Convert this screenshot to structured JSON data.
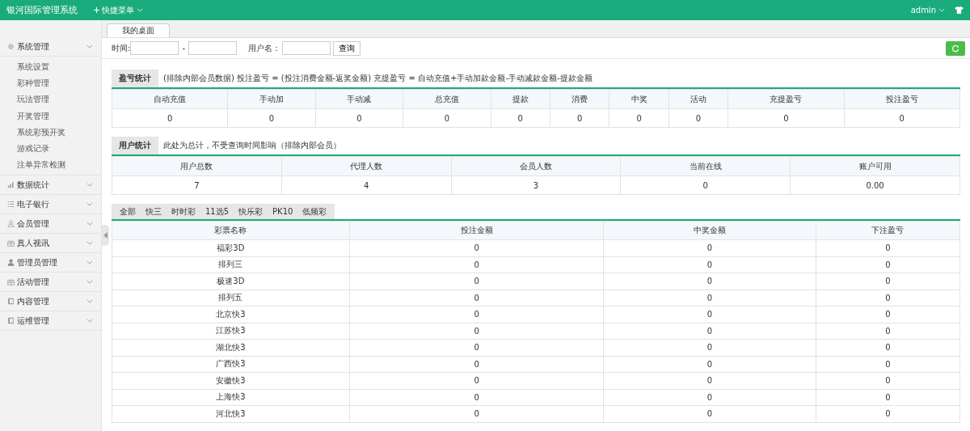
{
  "app_title": "银河国际管理系统",
  "quick_menu": "快捷菜单",
  "user": "admin",
  "sidebar": [
    {
      "label": "系统管理",
      "children": [
        {
          "label": "系统设置"
        },
        {
          "label": "彩种管理"
        },
        {
          "label": "玩法管理"
        },
        {
          "label": "开奖管理"
        },
        {
          "label": "系统彩预开奖"
        },
        {
          "label": "游戏记录"
        },
        {
          "label": "注单异常检测"
        }
      ]
    },
    {
      "label": "数据统计"
    },
    {
      "label": "电子银行"
    },
    {
      "label": "会员管理"
    },
    {
      "label": "真人视讯"
    },
    {
      "label": "管理员管理"
    },
    {
      "label": "活动管理"
    },
    {
      "label": "内容管理"
    },
    {
      "label": "运维管理"
    }
  ],
  "page_tabs": [
    {
      "label": "我的桌面",
      "selected": true
    }
  ],
  "filter": {
    "time_label": "时间:",
    "separator": "-",
    "user_label": "用户名：",
    "query_button": "查询"
  },
  "profit_stats": {
    "title": "盈亏统计",
    "note": "(排除内部会员数据)  投注盈亏 = (投注消费金额-返奖金额)     充提盈亏 = 自动充值+手动加款金额-手动减款金额-提款金额",
    "columns": [
      "自动充值",
      "手动加",
      "手动减",
      "总充值",
      "提款",
      "消费",
      "中奖",
      "活动",
      "充提盈亏",
      "投注盈亏"
    ],
    "values": [
      "0",
      "0",
      "0",
      "0",
      "0",
      "0",
      "0",
      "0",
      "0",
      "0"
    ]
  },
  "user_stats": {
    "title": "用户统计",
    "note": "此处为总计，不受查询时间影响（排除内部会员）",
    "columns": [
      "用户总数",
      "代理人数",
      "会员人数",
      "当前在线",
      "账户可用"
    ],
    "values": [
      "7",
      "4",
      "3",
      "0",
      "0.00"
    ]
  },
  "lottery_tabs": [
    {
      "label": "全部",
      "selected": false
    },
    {
      "label": "快三",
      "selected": false
    },
    {
      "label": "时时彩",
      "selected": false
    },
    {
      "label": "11选5",
      "selected": false
    },
    {
      "label": "快乐彩",
      "selected": false
    },
    {
      "label": "PK10",
      "selected": false
    },
    {
      "label": "低频彩",
      "selected": false
    }
  ],
  "lottery_table": {
    "columns": [
      "彩票名称",
      "投注金额",
      "中奖金额",
      "下注盈亏"
    ],
    "rows": [
      [
        "福彩3D",
        "0",
        "0",
        "0"
      ],
      [
        "排列三",
        "0",
        "0",
        "0"
      ],
      [
        "极速3D",
        "0",
        "0",
        "0"
      ],
      [
        "排列五",
        "0",
        "0",
        "0"
      ],
      [
        "北京快3",
        "0",
        "0",
        "0"
      ],
      [
        "江苏快3",
        "0",
        "0",
        "0"
      ],
      [
        "湖北快3",
        "0",
        "0",
        "0"
      ],
      [
        "广西快3",
        "0",
        "0",
        "0"
      ],
      [
        "安徽快3",
        "0",
        "0",
        "0"
      ],
      [
        "上海快3",
        "0",
        "0",
        "0"
      ],
      [
        "河北快3",
        "0",
        "0",
        "0"
      ]
    ]
  }
}
